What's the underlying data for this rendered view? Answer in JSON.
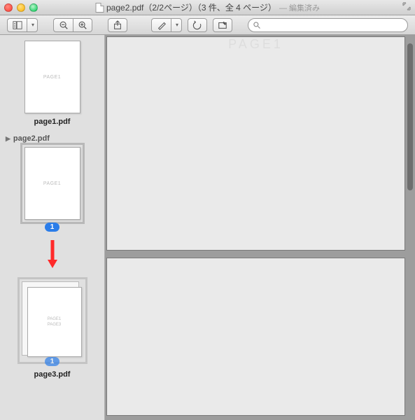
{
  "window": {
    "title_main": "page2.pdf（2/2ページ）（3 件、全 4 ページ）",
    "title_edited": "— 編集済み"
  },
  "toolbar": {
    "search_placeholder": ""
  },
  "sidebar": {
    "thumb1": {
      "content": "PAGE1",
      "label": "page1.pdf"
    },
    "section": {
      "label": "page2.pdf"
    },
    "thumb2": {
      "content": "PAGE1",
      "badge": "1"
    },
    "thumb3": {
      "content_a": "PAGE1",
      "content_b": "PAGE3",
      "label": "page3.pdf",
      "badge": "1"
    }
  },
  "main": {
    "page_text": "PAGE1"
  }
}
